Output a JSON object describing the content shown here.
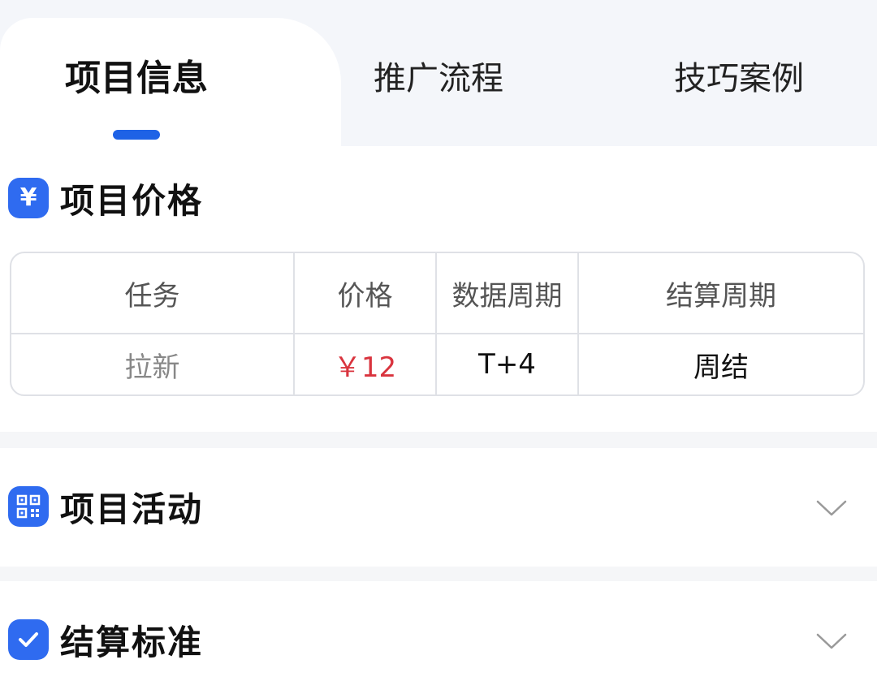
{
  "tabs": [
    {
      "label": "项目信息",
      "active": true
    },
    {
      "label": "推广流程",
      "active": false
    },
    {
      "label": "技巧案例",
      "active": false
    }
  ],
  "colors": {
    "accent": "#1e62e6",
    "price": "#d9343e"
  },
  "sections": {
    "price": {
      "icon": "yen-icon",
      "icon_glyph": "¥",
      "title": "项目价格",
      "table": {
        "headers": [
          "任务",
          "价格",
          "数据周期",
          "结算周期"
        ],
        "rows": [
          [
            "拉新",
            "￥12",
            "T+4",
            "周结"
          ]
        ]
      }
    },
    "activity": {
      "icon": "qr-code-icon",
      "title": "项目活动",
      "expanded": false
    },
    "settlement": {
      "icon": "check-icon",
      "title": "结算标准",
      "expanded": false
    }
  }
}
